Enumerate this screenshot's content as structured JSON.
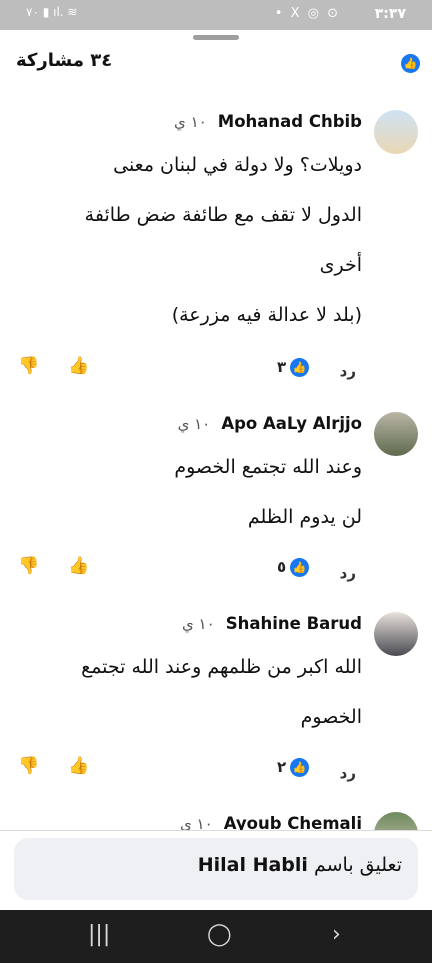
{
  "status": {
    "time": "٣:٣٧",
    "right_icons": "• X ◎ ⊙",
    "left_icons": "٧٠ ▮ ıl. ≋"
  },
  "header": {
    "title": "٣٤ مشاركة"
  },
  "comments": [
    {
      "name": "Mohanad Chbib",
      "time": "١٠ ي",
      "lines": [
        "دويلات؟ ولا دولة في لبنان معنى",
        "الدول لا تقف مع طائفة ضض طائفة",
        "أخرى",
        "(بلد لا عدالة فيه مزرعة)"
      ],
      "reply": "رد",
      "reactions": "٣"
    },
    {
      "name": "Apo AaLy Alrjjo",
      "time": "١٠ ي",
      "lines": [
        "وعند الله تجتمع الخصوم",
        "لن يدوم الظلم"
      ],
      "reply": "رد",
      "reactions": "٥"
    },
    {
      "name": "Shahine Barud",
      "time": "١٠ ي",
      "lines": [
        "الله اكبر من ظلمهم وعند الله تجتمع",
        "الخصوم"
      ],
      "reply": "رد",
      "reactions": "٢"
    },
    {
      "name": "Ayoub Chemali",
      "time": "١٠ ي"
    }
  ],
  "composer": {
    "prefix": "تعليق باسم",
    "user": "Hilal Habli"
  },
  "colors": {
    "accent": "#1877f2",
    "navbar": "#1e1e1e"
  },
  "icons": {
    "like": "thumbs-up-icon",
    "dislike": "thumbs-down-icon",
    "reaction": "like-reaction-icon"
  }
}
